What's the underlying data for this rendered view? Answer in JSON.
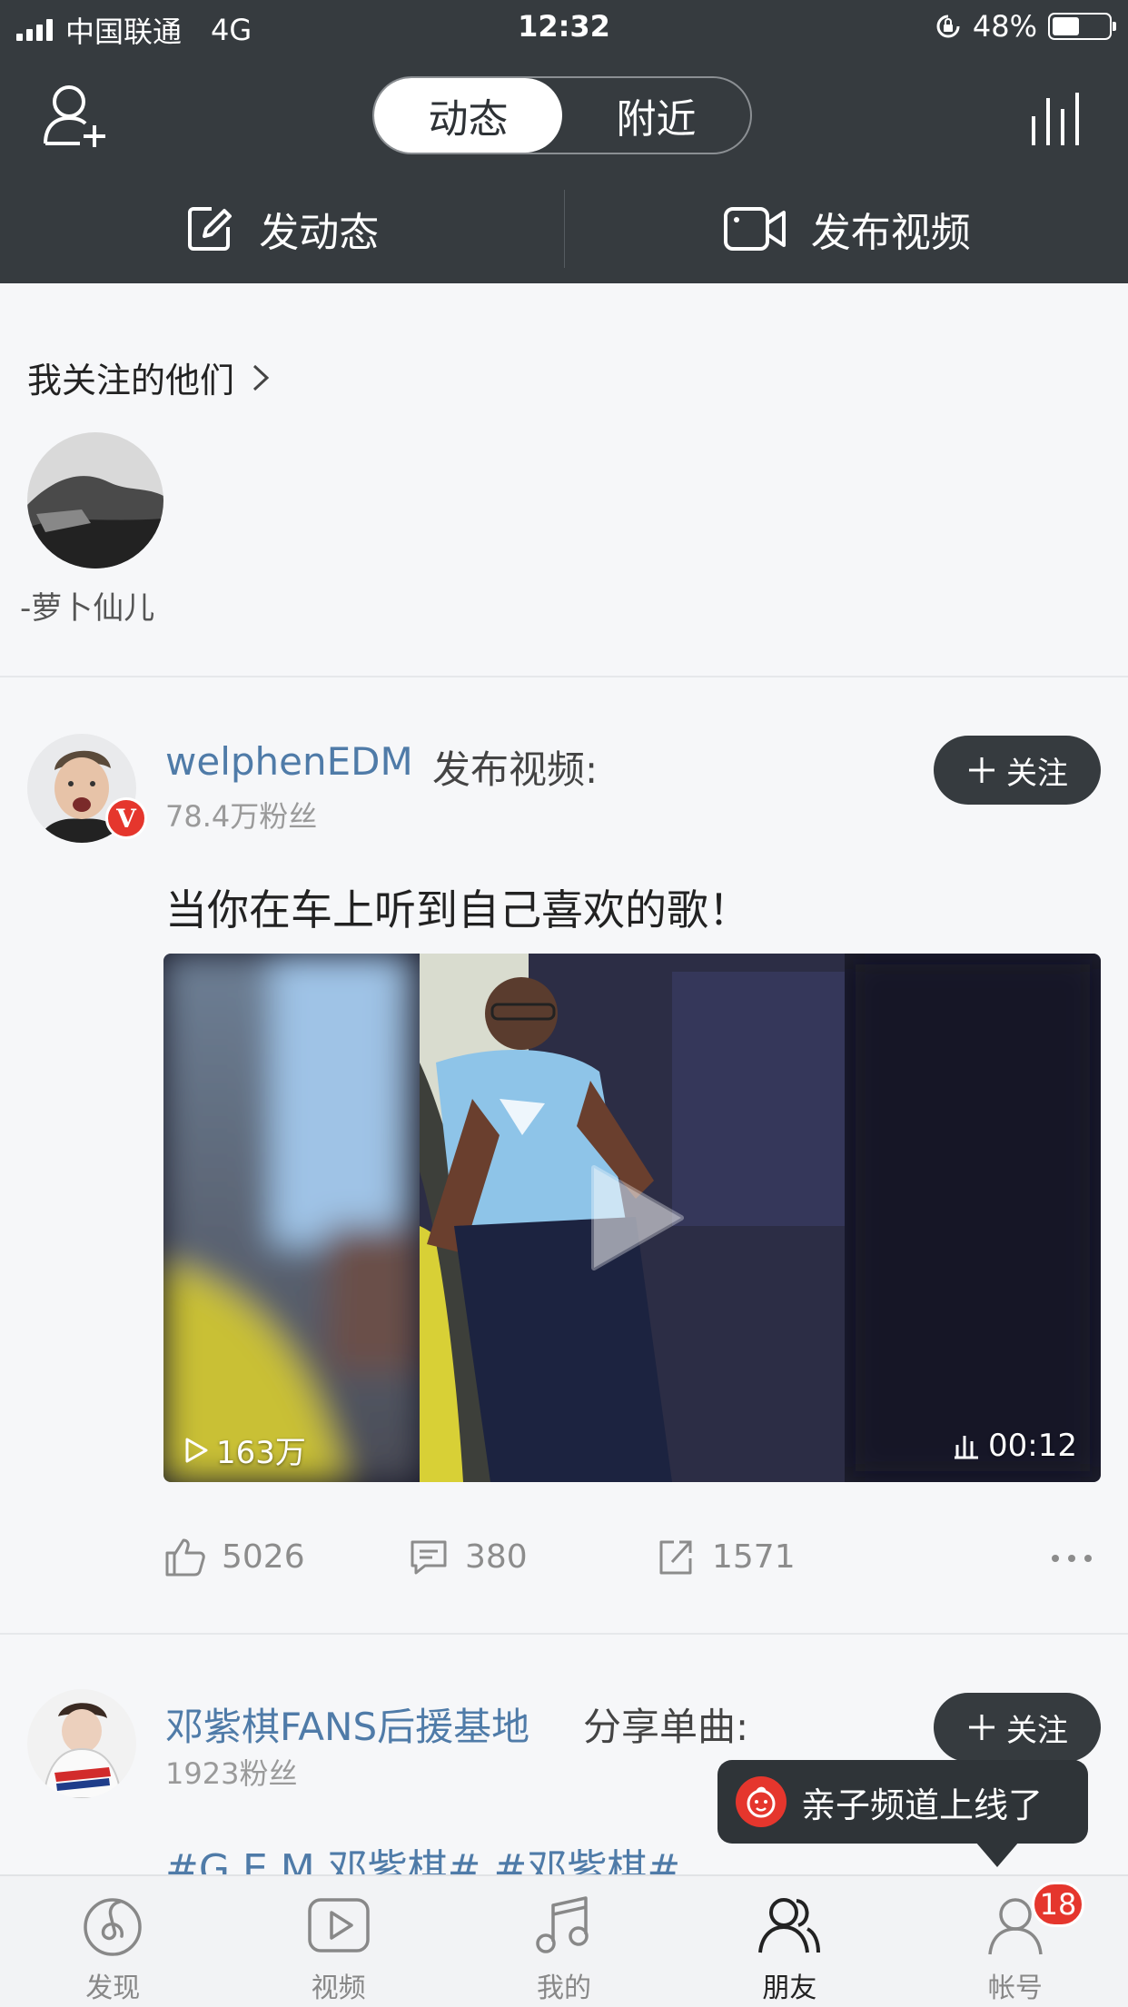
{
  "status_bar": {
    "carrier": "中国联通",
    "network": "4G",
    "time": "12:32",
    "battery": "48%",
    "battery_level": 0.48
  },
  "header": {
    "segments": [
      {
        "label": "动态",
        "active": true
      },
      {
        "label": "附近",
        "active": false
      }
    ],
    "post_status_label": "发动态",
    "post_video_label": "发布视频"
  },
  "following": {
    "title": "我关注的他们",
    "users": [
      {
        "name": "-萝卜仙儿"
      }
    ]
  },
  "feed": [
    {
      "username": "welphenEDM",
      "action": "发布视频:",
      "fans": "78.4万粉丝",
      "verified": true,
      "follow_label": "关注",
      "caption": "当你在车上听到自己喜欢的歌！",
      "video": {
        "views": "163万",
        "duration": "00:12"
      },
      "likes": "5026",
      "comments": "380",
      "shares": "1571"
    },
    {
      "username": "邓紫棋FANS后援基地",
      "action": "分享单曲:",
      "fans": "1923粉丝",
      "follow_label": "关注",
      "caption": "#G.E.M.邓紫棋# #邓紫棋#"
    }
  ],
  "toast": {
    "text": "亲子频道上线了"
  },
  "tabbar": {
    "tabs": [
      {
        "label": "发现",
        "icon": "discover-icon"
      },
      {
        "label": "视频",
        "icon": "video-icon"
      },
      {
        "label": "我的",
        "icon": "music-icon"
      },
      {
        "label": "朋友",
        "icon": "friends-icon",
        "active": true
      },
      {
        "label": "帐号",
        "icon": "account-icon",
        "badge": "18"
      }
    ]
  },
  "colors": {
    "header_bg": "#363b3f",
    "link": "#4f7ba8",
    "accent_red": "#e5362d",
    "background": "#f6f7f9"
  }
}
